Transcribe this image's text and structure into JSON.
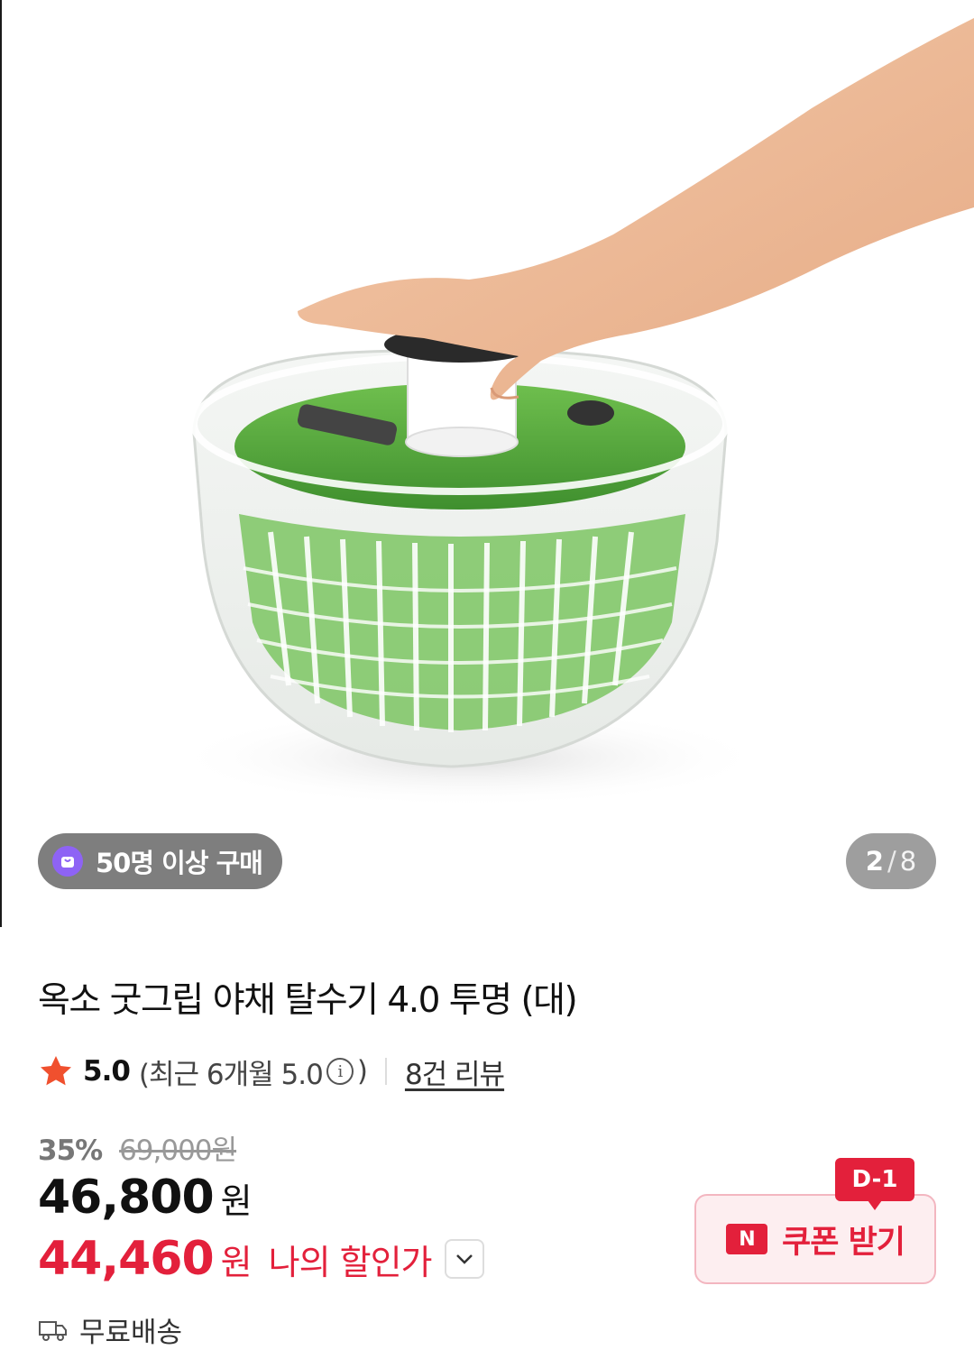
{
  "gallery": {
    "buyers_badge": "50명 이상 구매",
    "current_page": "2",
    "page_separator": "/",
    "total_pages": "8"
  },
  "product": {
    "title": "옥소 굿그립 야채 탈수기 4.0 투명 (대)"
  },
  "rating": {
    "score": "5.0",
    "recent_label": "(최근 6개월 5.0",
    "recent_close": ")",
    "info_glyph": "i",
    "review_link": "8건 리뷰"
  },
  "price": {
    "discount_rate": "35%",
    "original_price": "69,000원",
    "sale_price": "46,800",
    "currency": "원",
    "my_price": "44,460",
    "my_price_label": "나의 할인가"
  },
  "coupon": {
    "d_day": "D-1",
    "n_icon": "N",
    "label": "쿠폰 받기"
  },
  "shipping": {
    "label": "무료배송"
  },
  "icons": {
    "star": "star-icon",
    "bag": "shopping-bag-icon",
    "info": "info-icon",
    "chevron": "chevron-down-icon",
    "truck": "truck-icon"
  },
  "colors": {
    "accent_red": "#e3203b",
    "star_orange": "#f0502e",
    "badge_purple": "#8e63f5"
  }
}
